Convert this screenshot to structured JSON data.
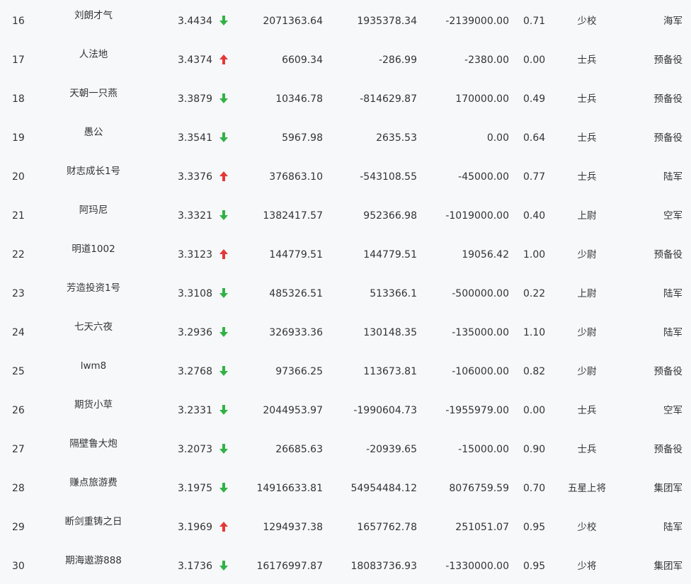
{
  "colors": {
    "up": "#e53935",
    "down": "#2fb344",
    "text": "#333333",
    "background": "#f7f8fa"
  },
  "rows": [
    {
      "rank": "16",
      "name": "刘朗才气",
      "score": "3.4434",
      "trend": "down",
      "v1": "2071363.64",
      "v2": "1935378.34",
      "v3": "-2139000.00",
      "ratio": "0.71",
      "level": "少校",
      "type": "海军"
    },
    {
      "rank": "17",
      "name": "人法地",
      "score": "3.4374",
      "trend": "up",
      "v1": "6609.34",
      "v2": "-286.99",
      "v3": "-2380.00",
      "ratio": "0.00",
      "level": "士兵",
      "type": "预备役"
    },
    {
      "rank": "18",
      "name": "天朝一只燕",
      "score": "3.3879",
      "trend": "down",
      "v1": "10346.78",
      "v2": "-814629.87",
      "v3": "170000.00",
      "ratio": "0.49",
      "level": "士兵",
      "type": "预备役"
    },
    {
      "rank": "19",
      "name": "愚公",
      "score": "3.3541",
      "trend": "down",
      "v1": "5967.98",
      "v2": "2635.53",
      "v3": "0.00",
      "ratio": "0.64",
      "level": "士兵",
      "type": "预备役"
    },
    {
      "rank": "20",
      "name": "财志成长1号",
      "score": "3.3376",
      "trend": "up",
      "v1": "376863.10",
      "v2": "-543108.55",
      "v3": "-45000.00",
      "ratio": "0.77",
      "level": "士兵",
      "type": "陆军"
    },
    {
      "rank": "21",
      "name": "阿玛尼",
      "score": "3.3321",
      "trend": "down",
      "v1": "1382417.57",
      "v2": "952366.98",
      "v3": "-1019000.00",
      "ratio": "0.40",
      "level": "上尉",
      "type": "空军"
    },
    {
      "rank": "22",
      "name": "明道1002",
      "score": "3.3123",
      "trend": "up",
      "v1": "144779.51",
      "v2": "144779.51",
      "v3": "19056.42",
      "ratio": "1.00",
      "level": "少尉",
      "type": "预备役"
    },
    {
      "rank": "23",
      "name": "芳造投资1号",
      "score": "3.3108",
      "trend": "down",
      "v1": "485326.51",
      "v2": "513366.1",
      "v3": "-500000.00",
      "ratio": "0.22",
      "level": "上尉",
      "type": "陆军"
    },
    {
      "rank": "24",
      "name": "七天六夜",
      "score": "3.2936",
      "trend": "down",
      "v1": "326933.36",
      "v2": "130148.35",
      "v3": "-135000.00",
      "ratio": "1.10",
      "level": "少尉",
      "type": "陆军"
    },
    {
      "rank": "25",
      "name": "lwm8",
      "score": "3.2768",
      "trend": "down",
      "v1": "97366.25",
      "v2": "113673.81",
      "v3": "-106000.00",
      "ratio": "0.82",
      "level": "少尉",
      "type": "预备役"
    },
    {
      "rank": "26",
      "name": "期货小草",
      "score": "3.2331",
      "trend": "down",
      "v1": "2044953.97",
      "v2": "-1990604.73",
      "v3": "-1955979.00",
      "ratio": "0.00",
      "level": "士兵",
      "type": "空军"
    },
    {
      "rank": "27",
      "name": "隔壁鲁大炮",
      "score": "3.2073",
      "trend": "down",
      "v1": "26685.63",
      "v2": "-20939.65",
      "v3": "-15000.00",
      "ratio": "0.90",
      "level": "士兵",
      "type": "预备役"
    },
    {
      "rank": "28",
      "name": "赚点旅游费",
      "score": "3.1975",
      "trend": "down",
      "v1": "14916633.81",
      "v2": "54954484.12",
      "v3": "8076759.59",
      "ratio": "0.70",
      "level": "五星上将",
      "type": "集团军"
    },
    {
      "rank": "29",
      "name": "断剑重铸之日",
      "score": "3.1969",
      "trend": "up",
      "v1": "1294937.38",
      "v2": "1657762.78",
      "v3": "251051.07",
      "ratio": "0.95",
      "level": "少校",
      "type": "陆军"
    },
    {
      "rank": "30",
      "name": "期海遨游888",
      "score": "3.1736",
      "trend": "down",
      "v1": "16176997.87",
      "v2": "18083736.93",
      "v3": "-1330000.00",
      "ratio": "0.95",
      "level": "少将",
      "type": "集团军"
    }
  ]
}
